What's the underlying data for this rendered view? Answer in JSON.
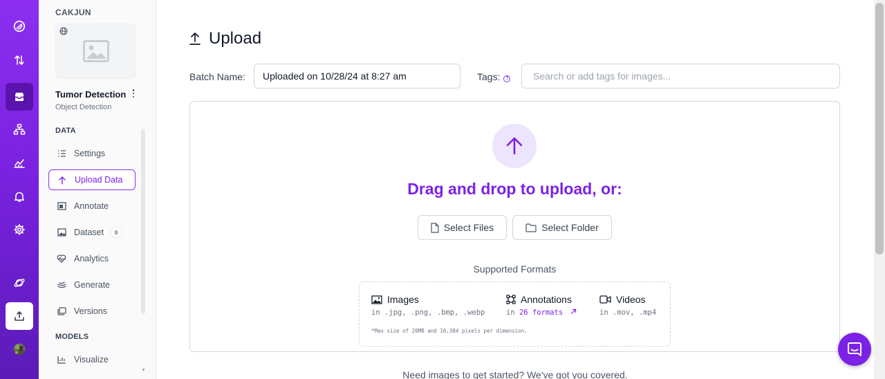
{
  "sidebar": {
    "workspace": "CAKJUN",
    "project_name": "Tumor Detection",
    "project_type": "Object Detection",
    "sections": {
      "data": "DATA",
      "models": "MODELS"
    },
    "items": [
      {
        "label": "Settings",
        "icon": "list-icon"
      },
      {
        "label": "Upload Data",
        "icon": "upload-icon",
        "active": true
      },
      {
        "label": "Annotate",
        "icon": "annotate-icon"
      },
      {
        "label": "Dataset",
        "icon": "image-icon",
        "badge": "0"
      },
      {
        "label": "Analytics",
        "icon": "heartbeat-icon"
      },
      {
        "label": "Generate",
        "icon": "generate-icon"
      },
      {
        "label": "Versions",
        "icon": "versions-icon"
      },
      {
        "label": "Visualize",
        "icon": "chart-icon"
      }
    ]
  },
  "main": {
    "title": "Upload",
    "batch_label": "Batch Name:",
    "batch_value": "Uploaded on 10/28/24 at 8:27 am",
    "tags_label": "Tags:",
    "tags_placeholder": "Search or add tags for images...",
    "dropzone": {
      "heading": "Drag and drop to upload, or:",
      "select_files": "Select Files",
      "select_folder": "Select Folder",
      "supported_title": "Supported Formats",
      "formats": {
        "images": {
          "title": "Images",
          "sub": "in .jpg, .png, .bmp, .webp"
        },
        "annotations": {
          "title": "Annotations",
          "prefix": "in",
          "link": "26 formats"
        },
        "videos": {
          "title": "Videos",
          "sub": "in .mov, .mp4"
        }
      },
      "note": "*Max size of 20MB and 16,384 pixels per dimension."
    },
    "footer": "Need images to get started? We've got you covered."
  },
  "colors": {
    "accent": "#7c22e6",
    "rail": "#8c2ff0"
  }
}
